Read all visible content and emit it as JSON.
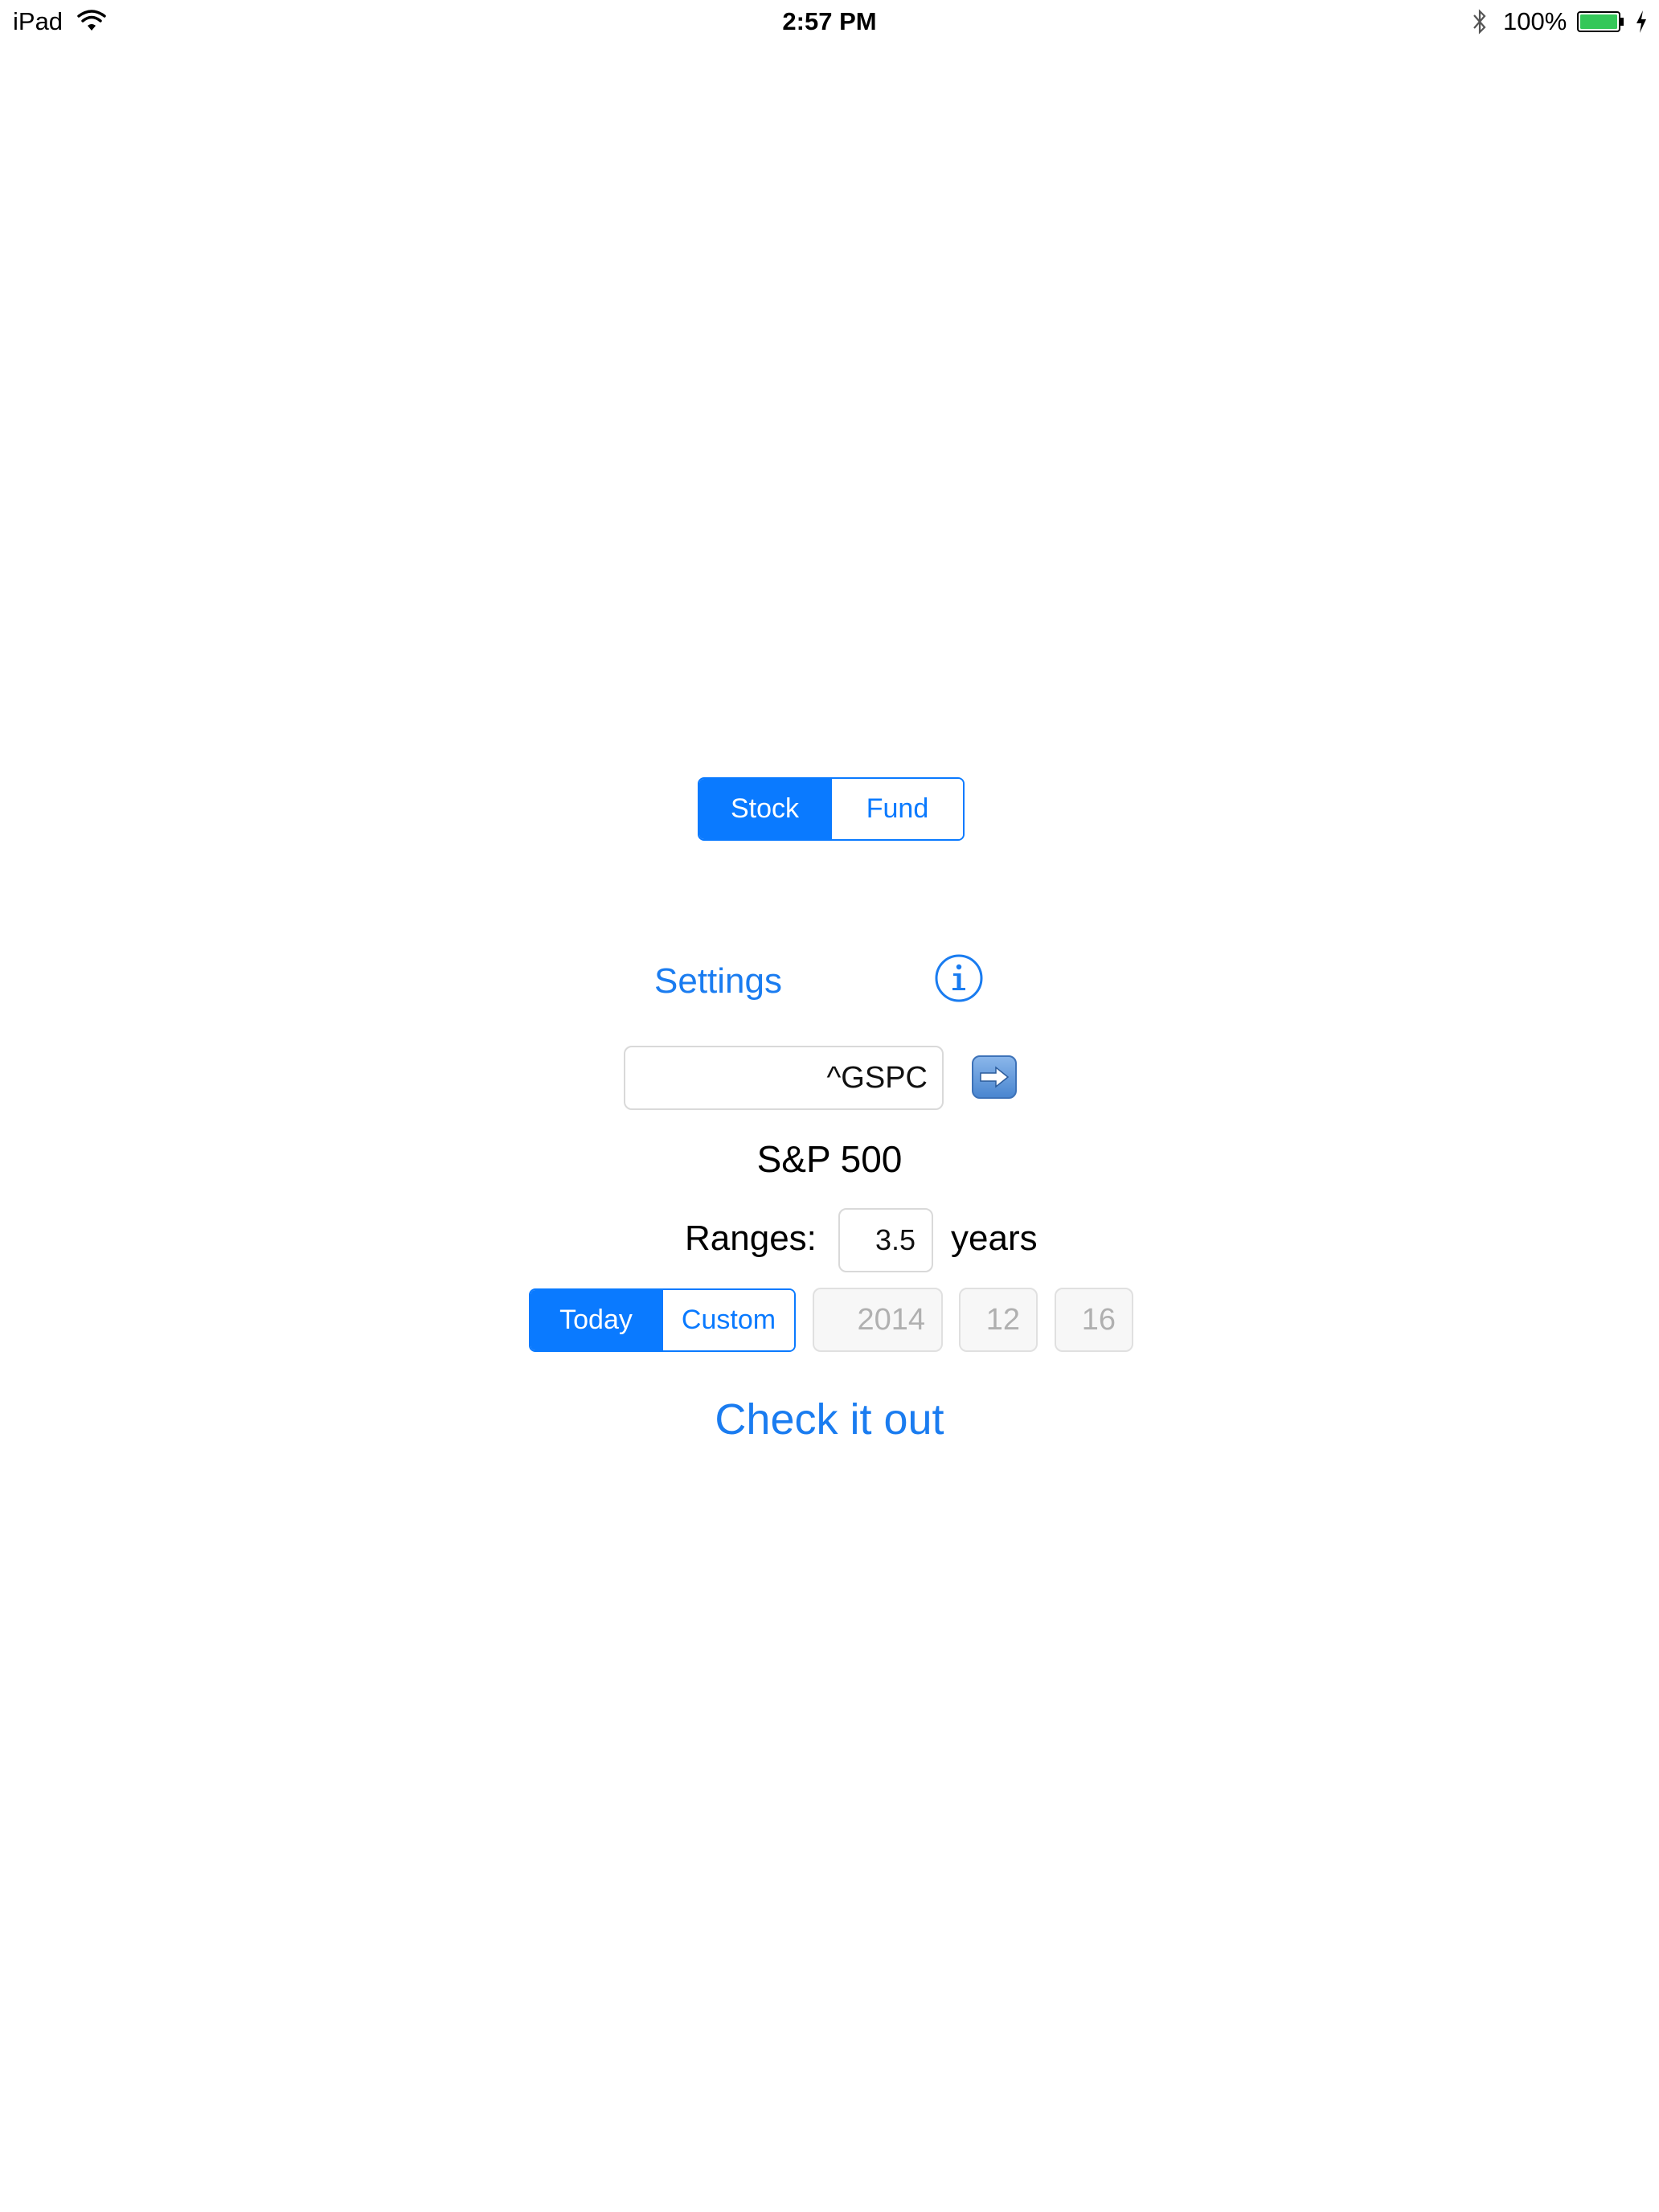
{
  "status_bar": {
    "device": "iPad",
    "time": "2:57 PM",
    "battery_percent": "100%",
    "battery_level": 1.0
  },
  "type_selector": {
    "options": [
      "Stock",
      "Fund"
    ],
    "selected": "Stock"
  },
  "settings": {
    "label": "Settings"
  },
  "symbol": {
    "value": "^GSPC",
    "name": "S&P 500"
  },
  "ranges": {
    "label": "Ranges:",
    "value": "3.5",
    "unit": "years"
  },
  "date_selector": {
    "options": [
      "Today",
      "Custom"
    ],
    "selected": "Today",
    "year": "2014",
    "month": "12",
    "day": "16"
  },
  "action": {
    "label": "Check it out"
  },
  "colors": {
    "accent": "#0a7aff",
    "battery": "#34c759"
  }
}
